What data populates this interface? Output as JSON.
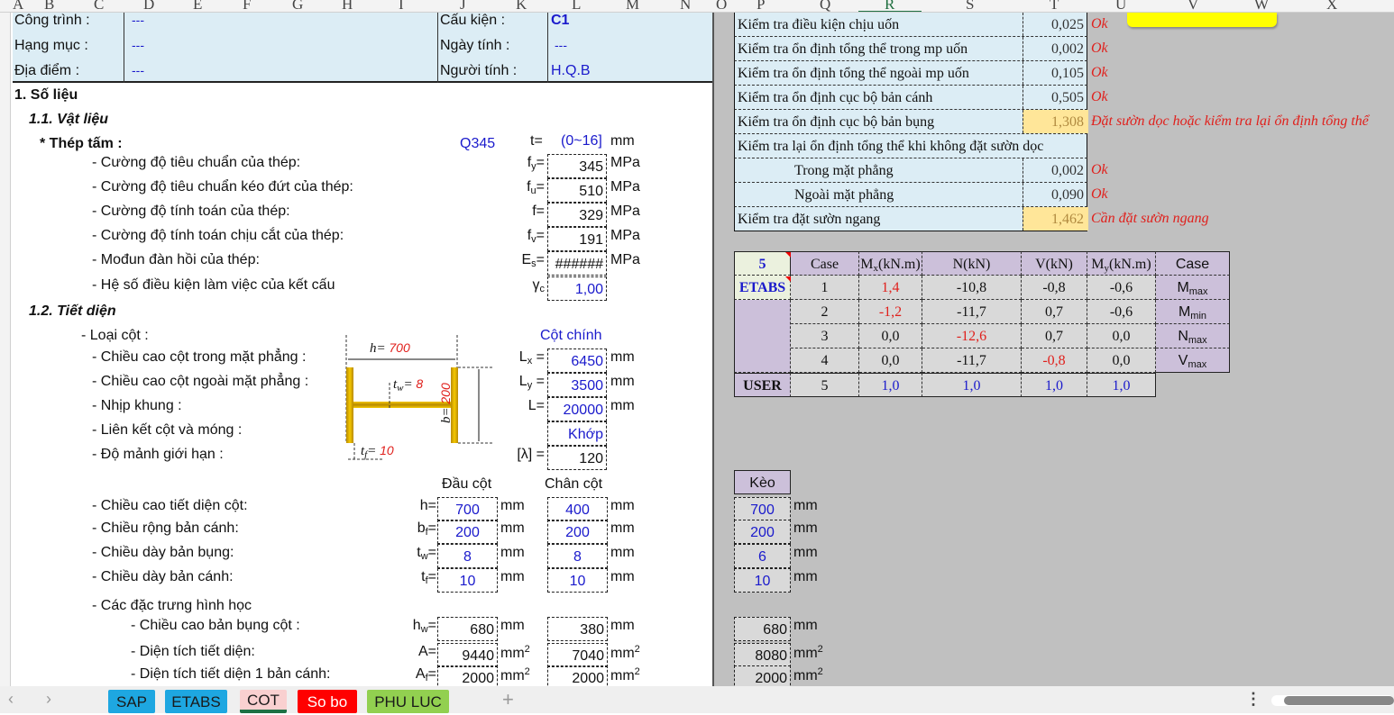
{
  "columns": [
    "A",
    "B",
    "C",
    "D",
    "E",
    "F",
    "G",
    "H",
    "I",
    "J",
    "K",
    "L",
    "M",
    "N",
    "O",
    "P",
    "Q",
    "R",
    "S",
    "T",
    "U",
    "V",
    "W",
    "X"
  ],
  "selected_column": "R",
  "header": {
    "cong_trinh_label": "Công trình :",
    "cong_trinh_value": "---",
    "hang_muc_label": "Hạng mục :",
    "hang_muc_value": "---",
    "dia_diem_label": "Địa điểm :",
    "dia_diem_value": "---",
    "cau_kien_label": "Cấu kiện :",
    "cau_kien_value": "C1",
    "ngay_tinh_label": "Ngày tính :",
    "ngay_tinh_value": "---",
    "nguoi_tinh_label": "Người tính :",
    "nguoi_tinh_value": "H.Q.B"
  },
  "section1": {
    "title": "1. Số liệu",
    "sub1": "1.1. Vật liệu",
    "steel_label": "* Thép tấm :",
    "grade": "Q345",
    "t_label": "t=",
    "t_range": "(0~16]",
    "t_unit": "mm"
  },
  "material_rows": [
    {
      "label": "- Cường độ tiêu chuẩn của thép:",
      "sym": "f",
      "sub": "y",
      "eq": "=",
      "value": "345",
      "unit": "MPa",
      "blue": false
    },
    {
      "label": "- Cường độ tiêu chuẩn kéo đứt của thép:",
      "sym": "f",
      "sub": "u",
      "eq": "=",
      "value": "510",
      "unit": "MPa",
      "blue": false
    },
    {
      "label": "- Cường độ tính toán của thép:",
      "sym": "f",
      "sub": "",
      "eq": "=",
      "value": "329",
      "unit": "MPa",
      "blue": false
    },
    {
      "label": "- Cường độ tính toán chịu cắt của thép:",
      "sym": "f",
      "sub": "v",
      "eq": "=",
      "value": "191",
      "unit": "MPa",
      "blue": false
    },
    {
      "label": "- Mođun đàn hồi của thép:",
      "sym": "E",
      "sub": "s",
      "eq": "=",
      "value": "######",
      "unit": "MPa",
      "blue": false
    },
    {
      "label": "- Hệ số điều kiện làm việc của kết cấu",
      "sym": "γ",
      "sub": "c",
      "eq": "",
      "value": "1,00",
      "unit": "",
      "blue": true
    }
  ],
  "section12": {
    "title": "1.2. Tiết diện",
    "col_type_label": "- Loại cột :",
    "col_type_value": "Cột chính"
  },
  "geometry_rows": [
    {
      "label": "- Chiều cao cột trong mặt phẳng :",
      "sym": "L",
      "sub": "x",
      "eq": " =",
      "value": "6450",
      "unit": "mm"
    },
    {
      "label": "- Chiều cao cột ngoài mặt phẳng :",
      "sym": "L",
      "sub": "y",
      "eq": " =",
      "value": "3500",
      "unit": "mm"
    },
    {
      "label": "- Nhịp khung :",
      "sym": "L",
      "sub": "",
      "eq": "=",
      "value": "20000",
      "unit": "mm"
    },
    {
      "label": "- Liên kết cột và móng :",
      "sym": "",
      "sub": "",
      "eq": "",
      "value": "Khớp",
      "unit": ""
    },
    {
      "label": "- Độ mảnh giới hạn :",
      "sym": "[λ]",
      "sub": "",
      "eq": " =",
      "value": "120",
      "unit": "",
      "black": true
    }
  ],
  "diagram": {
    "h_label": "h=",
    "h_value": "700",
    "tw_label": "t",
    "tw_sub": "w",
    "tw_value": "8",
    "b_label": "b=",
    "b_value": "200",
    "tf_label": "t",
    "tf_sub": "f",
    "tf_value": "10",
    "color": "#e0b000"
  },
  "section_headers": {
    "dau_cot": "Đầu cột",
    "chan_cot": "Chân cột",
    "keo": "Kèo"
  },
  "section_rows": [
    {
      "label": "- Chiều cao tiết diện cột:",
      "sym": "h",
      "sub": "",
      "dau": "700",
      "chan": "400",
      "keo": "700",
      "unit": "mm",
      "sup": ""
    },
    {
      "label": "- Chiều rộng bản cánh:",
      "sym": "b",
      "sub": "f",
      "dau": "200",
      "chan": "200",
      "keo": "200",
      "unit": "mm",
      "sup": ""
    },
    {
      "label": "- Chiều dày bản bụng:",
      "sym": "t",
      "sub": "w",
      "dau": "8",
      "chan": "8",
      "keo": "6",
      "unit": "mm",
      "sup": ""
    },
    {
      "label": "- Chiều dày bản cánh:",
      "sym": "t",
      "sub": "f",
      "dau": "10",
      "chan": "10",
      "keo": "10",
      "unit": "mm",
      "sup": ""
    }
  ],
  "geom_props_label": "- Các đặc trưng hình học",
  "geom_props_rows": [
    {
      "label": "- Chiều cao bản bụng cột :",
      "sym": "h",
      "sub": "w",
      "dau": "680",
      "chan": "380",
      "keo": "680",
      "unit": "mm",
      "sup": ""
    },
    {
      "label": "- Diện tích tiết diện:",
      "sym": "A",
      "sub": "",
      "dau": "9440",
      "chan": "7040",
      "keo": "8080",
      "unit": "mm",
      "sup": "2"
    },
    {
      "label": "- Diện tích tiết diện 1 bản cánh:",
      "sym": "A",
      "sub": "f",
      "dau": "2000",
      "chan": "2000",
      "keo": "2000",
      "unit": "mm",
      "sup": "2"
    }
  ],
  "checks": [
    {
      "label": "Kiểm tra điều kiện chịu uốn",
      "value": "0,025",
      "status": "Ok",
      "warn": false,
      "indent": false
    },
    {
      "label": "Kiểm tra ổn định tổng thể trong mp uốn",
      "value": "0,002",
      "status": "Ok",
      "warn": false,
      "indent": false
    },
    {
      "label": "Kiểm tra ổn định tổng thể ngoài mp uốn",
      "value": "0,105",
      "status": "Ok",
      "warn": false,
      "indent": false
    },
    {
      "label": "Kiểm tra ổn định cục bộ bản cánh",
      "value": "0,505",
      "status": "Ok",
      "warn": false,
      "indent": false
    },
    {
      "label": "Kiểm tra ổn định cục bộ bản bụng",
      "value": "1,308",
      "status": "Đặt sườn dọc hoặc kiểm tra lại ổn định tổng thể",
      "warn": true,
      "indent": false
    },
    {
      "label": "Kiểm tra lại ổn định tổng thể khi không đặt sườn dọc",
      "value": null,
      "status": "",
      "warn": false,
      "indent": false,
      "full": true
    },
    {
      "label": "Trong mặt phẳng",
      "value": "0,002",
      "status": "Ok",
      "warn": false,
      "indent": true
    },
    {
      "label": "Ngoài mặt phẳng",
      "value": "0,090",
      "status": "Ok",
      "warn": false,
      "indent": true
    },
    {
      "label": "Kiểm tra đặt sườn ngang",
      "value": "1,462",
      "status": "Cần đặt sườn ngang",
      "warn": true,
      "indent": false
    }
  ],
  "forces": {
    "selector_value": "5",
    "source": "ETABS",
    "user_label": "USER",
    "headers": [
      {
        "t": "Case"
      },
      {
        "t": "M",
        "s": "x",
        "u": "(kN.m)"
      },
      {
        "t": "N(kN)"
      },
      {
        "t": "V(kN)"
      },
      {
        "t": "M",
        "s": "y",
        "u": "(kN.m)"
      },
      {
        "t": "Case"
      }
    ],
    "rows": [
      {
        "case": "1",
        "mx": "1,4",
        "n": "-10,8",
        "v": "-0,8",
        "my": "-0,6",
        "type": "M",
        "type_sub": "max",
        "red": "mx"
      },
      {
        "case": "2",
        "mx": "-1,2",
        "n": "-11,7",
        "v": "0,7",
        "my": "-0,6",
        "type": "M",
        "type_sub": "min",
        "red": "mx"
      },
      {
        "case": "3",
        "mx": "0,0",
        "n": "-12,6",
        "v": "0,7",
        "my": "0,0",
        "type": "N",
        "type_sub": "max",
        "red": "n"
      },
      {
        "case": "4",
        "mx": "0,0",
        "n": "-11,7",
        "v": "-0,8",
        "my": "0,0",
        "type": "V",
        "type_sub": "max",
        "red": "v"
      }
    ],
    "user_row": {
      "case": "5",
      "mx": "1,0",
      "n": "1,0",
      "v": "1,0",
      "my": "1,0"
    }
  },
  "tabs": [
    {
      "label": "SAP",
      "bg": "#1ea7e1",
      "fg": "#1a1a1a"
    },
    {
      "label": "ETABS",
      "bg": "#1ea7e1",
      "fg": "#1a1a1a"
    },
    {
      "label": "COT",
      "bg": "#f9d0d0",
      "fg": "#1a1a1a",
      "active": true
    },
    {
      "label": "So bo",
      "bg": "#ff0000",
      "fg": "#ffffff"
    },
    {
      "label": "PHU LUC",
      "bg": "#92d050",
      "fg": "#1a1a1a"
    }
  ],
  "add_sheet_label": "+",
  "colors": {
    "header_band": "#dcedf5",
    "warn_cell": "#ffe699",
    "input_blue": "#1a1acc",
    "status_red": "#e0201c",
    "pane_gray": "#c0c0c0"
  }
}
